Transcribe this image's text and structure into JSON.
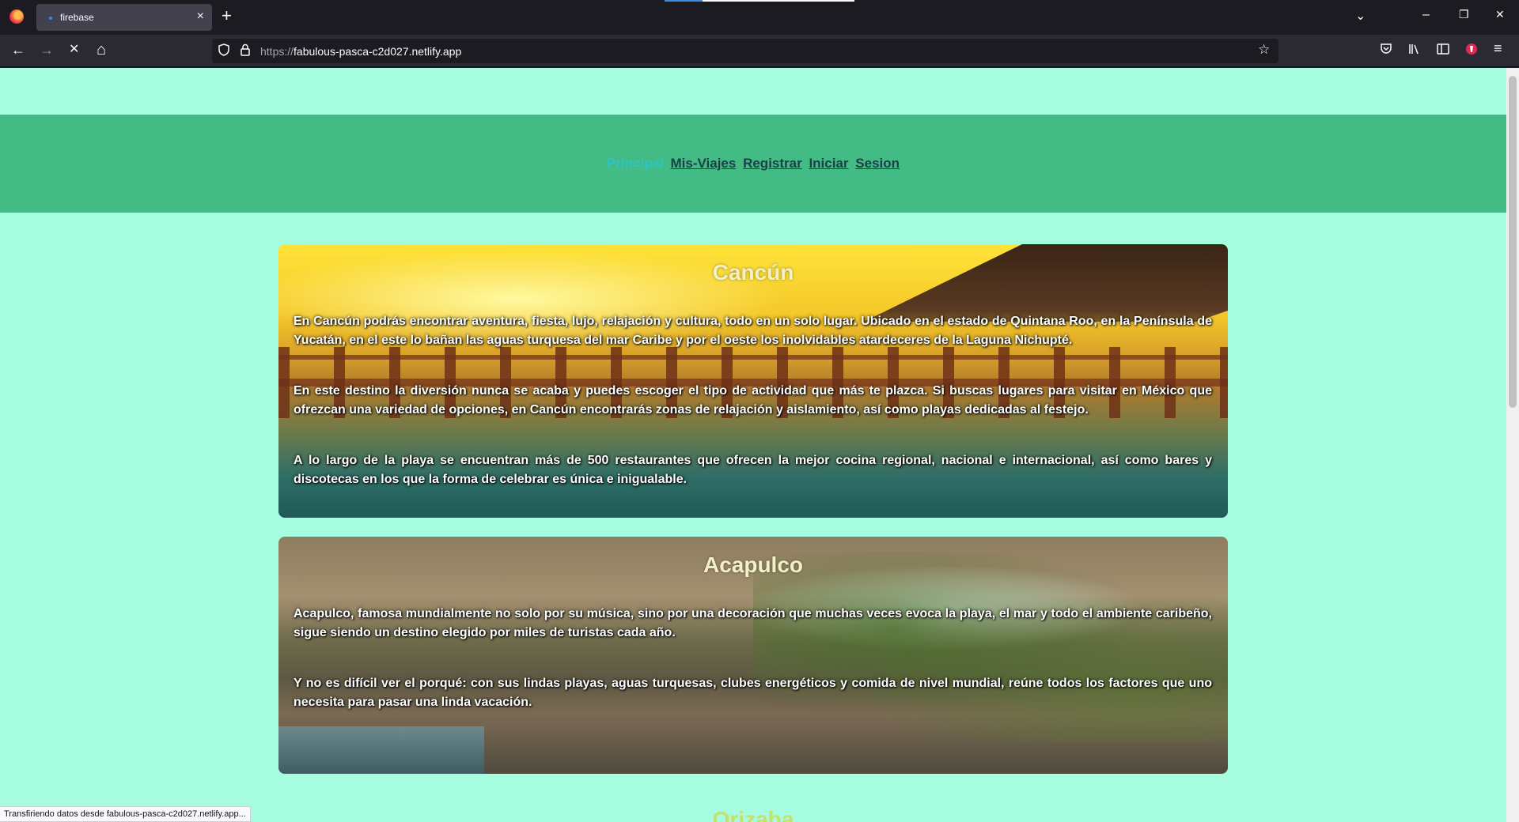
{
  "browser": {
    "tab_title": "firebase",
    "tab_close": "×",
    "new_tab": "+",
    "window_controls": {
      "list_all_tabs": "⌄",
      "minimize": "–",
      "restore": "❐",
      "close": "✕"
    },
    "nav": {
      "back": "←",
      "forward": "→",
      "stop": "✕",
      "home": "⌂"
    },
    "url": {
      "scheme": "https://",
      "host": "fabulous-pasca-c2d027.netlify.app"
    },
    "status_text": "Transfiriendo datos desde fabulous-pasca-c2d027.netlify.app..."
  },
  "site": {
    "nav": [
      {
        "label": "Principal",
        "active": true
      },
      {
        "label": "Mis-Viajes",
        "active": false
      },
      {
        "label": "Registrar",
        "active": false
      },
      {
        "label": "Iniciar",
        "active": false
      },
      {
        "label": "Sesion",
        "active": false
      }
    ],
    "cards": [
      {
        "title": "Cancún",
        "paragraphs": [
          "En Cancún podrás encontrar aventura, fiesta, lujo, relajación y cultura, todo en un solo lugar. Ubicado en el estado de Quintana Roo, en la Península de Yucatán, en el este lo bañan las aguas turquesa del mar Caribe y por el oeste los inolvidables atardeceres de la Laguna Nichupté.",
          "En este destino la diversión nunca se acaba y puedes escoger el tipo de actividad que más te plazca. Si buscas lugares para visitar en México que ofrezcan una variedad de opciones, en Cancún encontrarás zonas de relajación y aislamiento, así como playas dedicadas al festejo.",
          "A lo largo de la playa se encuentran más de 500 restaurantes que ofrecen la mejor cocina regional, nacional e internacional, así como bares y discotecas en los que la forma de celebrar es única e inigualable."
        ]
      },
      {
        "title": "Acapulco",
        "paragraphs": [
          "Acapulco, famosa mundialmente no solo por su música, sino por una decoración que muchas veces evoca la playa, el mar y todo el ambiente caribeño, sigue siendo un destino elegido por miles de turistas cada año.",
          "Y no es difícil ver el porqué: con sus lindas playas, aguas turquesas, clubes energéticos y comida de nivel mundial, reúne todos los factores que uno necesita para pasar una linda vacación."
        ]
      },
      {
        "title": "Orizaba"
      }
    ]
  }
}
